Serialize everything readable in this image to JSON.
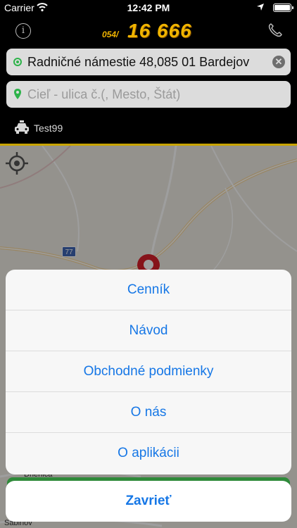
{
  "status_bar": {
    "carrier": "Carrier",
    "time": "12:42 PM"
  },
  "header": {
    "logo_prefix": "054/",
    "logo_number": "16 666",
    "logo_color": "#f0b400"
  },
  "pickup": {
    "value": "Radničné námestie 48,085 01 Bardejov",
    "clear_icon": "clear-circle-icon"
  },
  "destination": {
    "placeholder": "Cieľ - ulica č.(, Mesto, Štát)"
  },
  "car": {
    "label": "Test99"
  },
  "map": {
    "road_number": "77",
    "towns": [
      "Drienica",
      "Sabinov"
    ]
  },
  "menu": {
    "items": [
      "Cenník",
      "Návod",
      "Obchodné podmienky",
      "O nás",
      "O aplikácii"
    ],
    "cancel": "Zavrieť"
  },
  "colors": {
    "accent": "#1677e6",
    "gold": "#c9a400",
    "green": "#2db34a"
  }
}
